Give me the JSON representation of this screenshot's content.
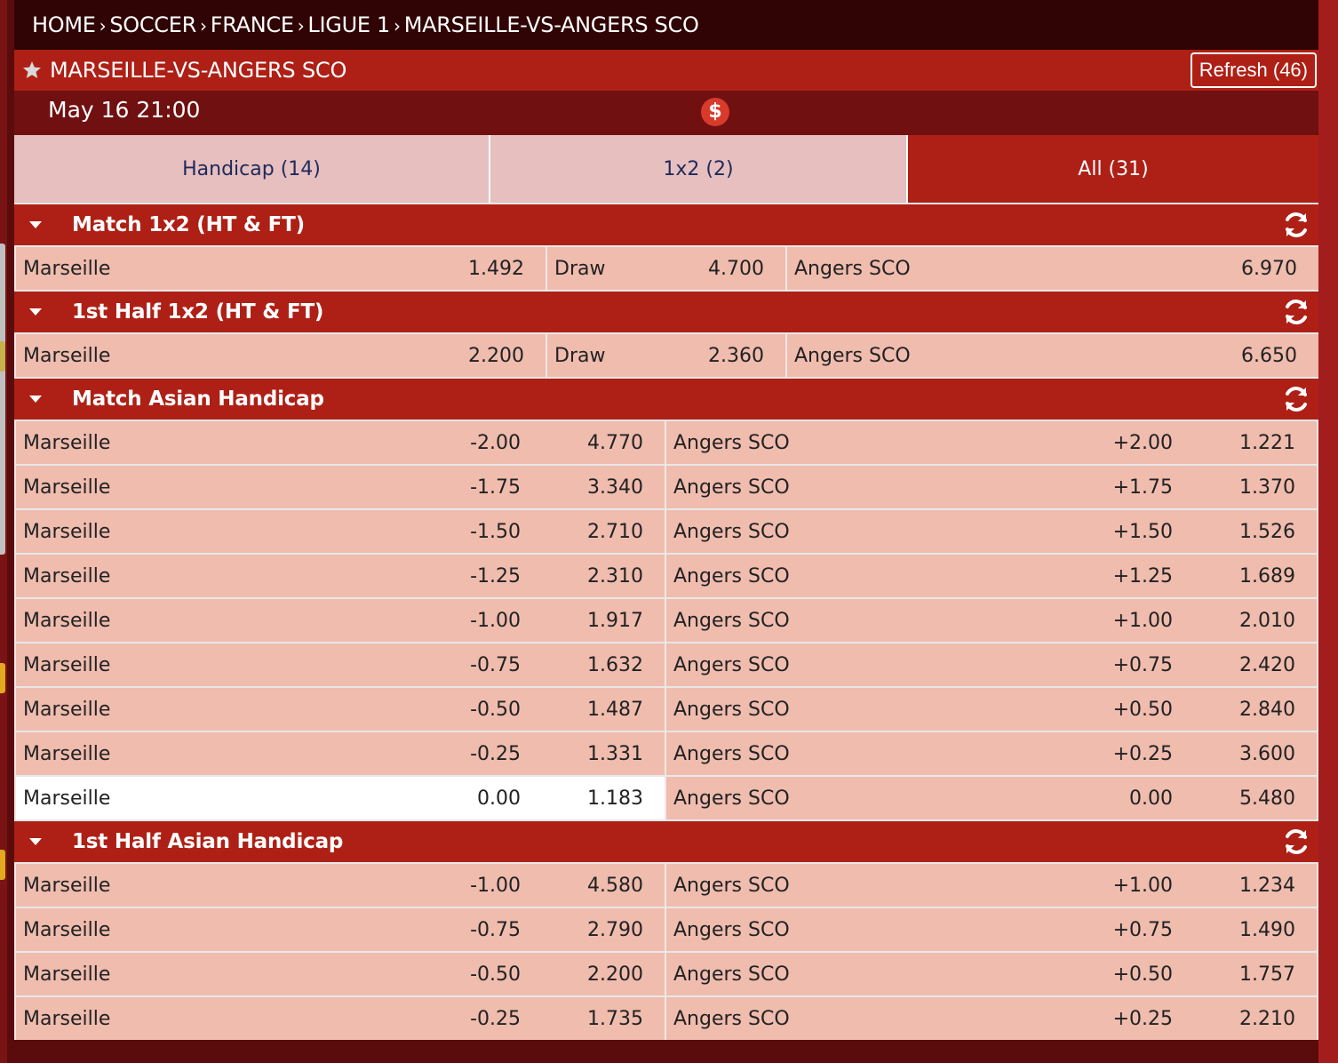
{
  "breadcrumb": [
    "HOME",
    "SOCCER",
    "FRANCE",
    "LIGUE 1",
    "MARSEILLE-VS-ANGERS SCO"
  ],
  "event": {
    "title": "MARSEILLE-VS-ANGERS SCO",
    "refresh_label": "Refresh (46)",
    "datetime": "May 16 21:00",
    "dollar_symbol": "$"
  },
  "tabs": [
    {
      "label": "Handicap (14)",
      "active": false
    },
    {
      "label": "1x2 (2)",
      "active": false
    },
    {
      "label": "All (31)",
      "active": true
    }
  ],
  "sections": [
    {
      "title": "Match 1x2 (HT & FT)",
      "type": "1x2",
      "rows": [
        {
          "home": "Marseille",
          "home_odds": "1.492",
          "draw": "Draw",
          "draw_odds": "4.700",
          "away": "Angers SCO",
          "away_odds": "6.970"
        }
      ]
    },
    {
      "title": "1st Half 1x2 (HT & FT)",
      "type": "1x2",
      "rows": [
        {
          "home": "Marseille",
          "home_odds": "2.200",
          "draw": "Draw",
          "draw_odds": "2.360",
          "away": "Angers SCO",
          "away_odds": "6.650"
        }
      ]
    },
    {
      "title": "Match Asian Handicap",
      "type": "handicap",
      "rows": [
        {
          "home": "Marseille",
          "home_hcap": "-2.00",
          "home_odds": "4.770",
          "away": "Angers SCO",
          "away_hcap": "+2.00",
          "away_odds": "1.221"
        },
        {
          "home": "Marseille",
          "home_hcap": "-1.75",
          "home_odds": "3.340",
          "away": "Angers SCO",
          "away_hcap": "+1.75",
          "away_odds": "1.370"
        },
        {
          "home": "Marseille",
          "home_hcap": "-1.50",
          "home_odds": "2.710",
          "away": "Angers SCO",
          "away_hcap": "+1.50",
          "away_odds": "1.526"
        },
        {
          "home": "Marseille",
          "home_hcap": "-1.25",
          "home_odds": "2.310",
          "away": "Angers SCO",
          "away_hcap": "+1.25",
          "away_odds": "1.689"
        },
        {
          "home": "Marseille",
          "home_hcap": "-1.00",
          "home_odds": "1.917",
          "away": "Angers SCO",
          "away_hcap": "+1.00",
          "away_odds": "2.010"
        },
        {
          "home": "Marseille",
          "home_hcap": "-0.75",
          "home_odds": "1.632",
          "away": "Angers SCO",
          "away_hcap": "+0.75",
          "away_odds": "2.420"
        },
        {
          "home": "Marseille",
          "home_hcap": "-0.50",
          "home_odds": "1.487",
          "away": "Angers SCO",
          "away_hcap": "+0.50",
          "away_odds": "2.840"
        },
        {
          "home": "Marseille",
          "home_hcap": "-0.25",
          "home_odds": "1.331",
          "away": "Angers SCO",
          "away_hcap": "+0.25",
          "away_odds": "3.600"
        },
        {
          "home": "Marseille",
          "home_hcap": "0.00",
          "home_odds": "1.183",
          "away": "Angers SCO",
          "away_hcap": "0.00",
          "away_odds": "5.480",
          "highlight_home": true
        }
      ]
    },
    {
      "title": "1st Half Asian Handicap",
      "type": "handicap",
      "rows": [
        {
          "home": "Marseille",
          "home_hcap": "-1.00",
          "home_odds": "4.580",
          "away": "Angers SCO",
          "away_hcap": "+1.00",
          "away_odds": "1.234"
        },
        {
          "home": "Marseille",
          "home_hcap": "-0.75",
          "home_odds": "2.790",
          "away": "Angers SCO",
          "away_hcap": "+0.75",
          "away_odds": "1.490"
        },
        {
          "home": "Marseille",
          "home_hcap": "-0.50",
          "home_odds": "2.200",
          "away": "Angers SCO",
          "away_hcap": "+0.50",
          "away_odds": "1.757"
        },
        {
          "home": "Marseille",
          "home_hcap": "-0.25",
          "home_odds": "1.735",
          "away": "Angers SCO",
          "away_hcap": "+0.25",
          "away_odds": "2.210"
        }
      ]
    }
  ],
  "colors": {
    "breadcrumb_bg": "#300404",
    "header_red": "#ae2016",
    "date_bg": "#701010",
    "tab_inactive": "#e7bfbf",
    "cell_bg": "#efbcae",
    "highlight_cell": "#ffffff"
  }
}
